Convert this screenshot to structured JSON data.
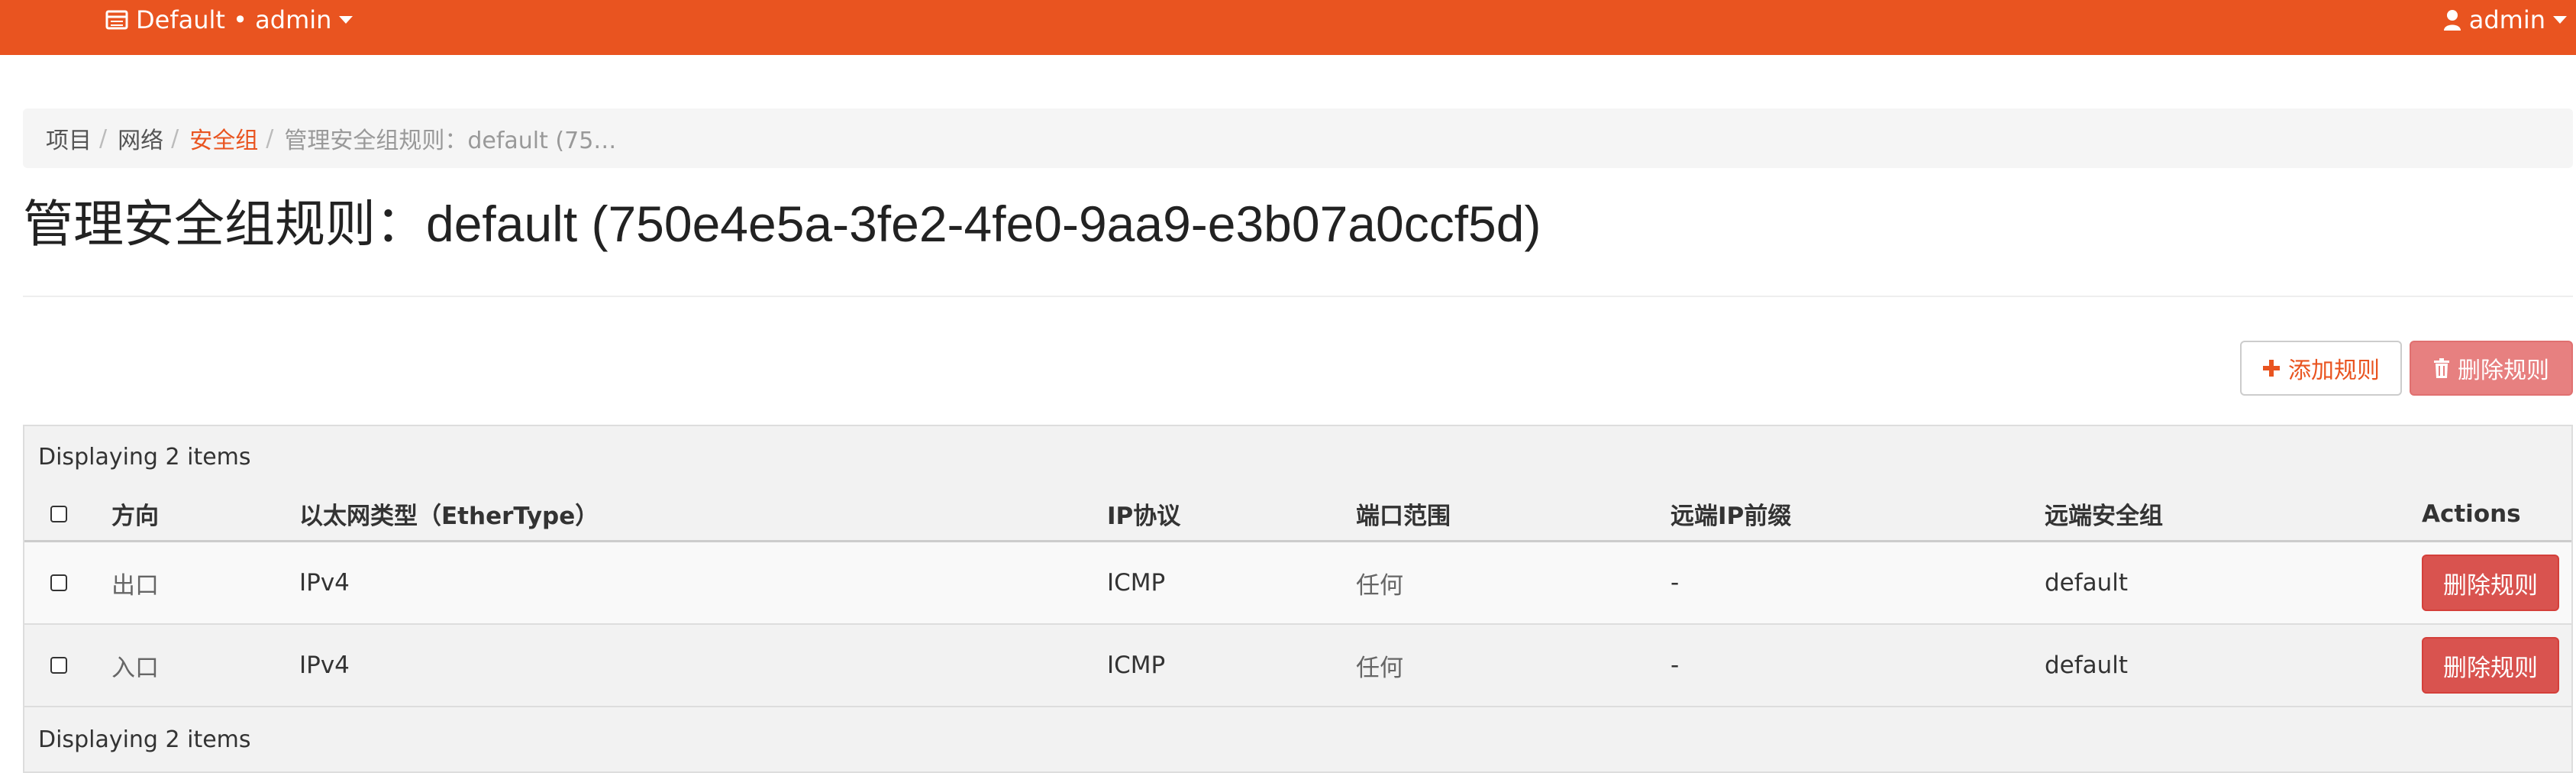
{
  "topbar": {
    "project": "Default • admin",
    "user": "admin"
  },
  "breadcrumb": {
    "items": [
      "项目",
      "网络",
      "安全组",
      "管理安全组规则：default (75…"
    ]
  },
  "page": {
    "title": "管理安全组规则：default (750e4e5a-3fe2-4fe0-9aa9-e3b07a0ccf5d)"
  },
  "actions": {
    "add_label": "添加规则",
    "delete_label": "删除规则"
  },
  "table": {
    "caption": "Displaying 2 items",
    "columns": [
      "方向",
      "以太网类型（EtherType）",
      "IP协议",
      "端口范围",
      "远端IP前缀",
      "远端安全组",
      "Actions"
    ],
    "rows": [
      {
        "direction": "出口",
        "ethertype": "IPv4",
        "protocol": "ICMP",
        "port_range": "任何",
        "remote_ip": "-",
        "remote_group": "default",
        "action": "删除规则"
      },
      {
        "direction": "入口",
        "ethertype": "IPv4",
        "protocol": "ICMP",
        "port_range": "任何",
        "remote_ip": "-",
        "remote_group": "default",
        "action": "删除规则"
      }
    ],
    "footer": "Displaying 2 items"
  },
  "colors": {
    "brand": "#e95420",
    "danger": "#d9534f"
  }
}
